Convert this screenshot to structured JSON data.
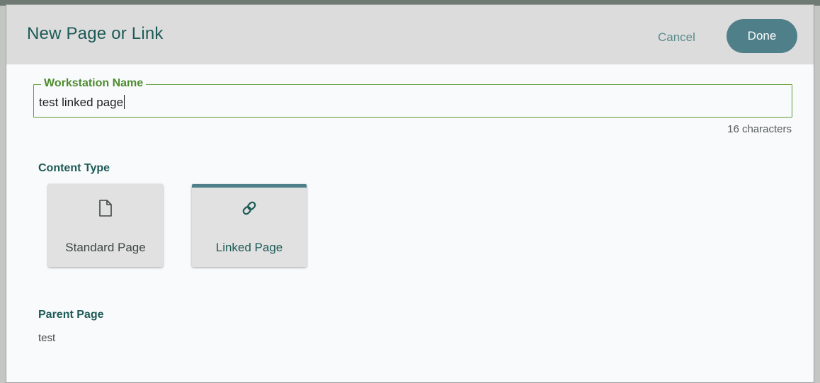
{
  "dialog": {
    "title": "New Page or Link",
    "cancel_label": "Cancel",
    "done_label": "Done"
  },
  "name_field": {
    "legend": "Workstation Name",
    "value": "test linked page",
    "char_count": "16 characters"
  },
  "content_type": {
    "label": "Content Type",
    "options": [
      {
        "label": "Standard Page",
        "icon": "document-icon",
        "selected": false
      },
      {
        "label": "Linked Page",
        "icon": "link-icon",
        "selected": true
      }
    ]
  },
  "parent_page": {
    "label": "Parent Page",
    "value": "test"
  },
  "colors": {
    "accent": "#4f7f89",
    "title": "#1d5a56",
    "field_border": "#5f9c36"
  }
}
